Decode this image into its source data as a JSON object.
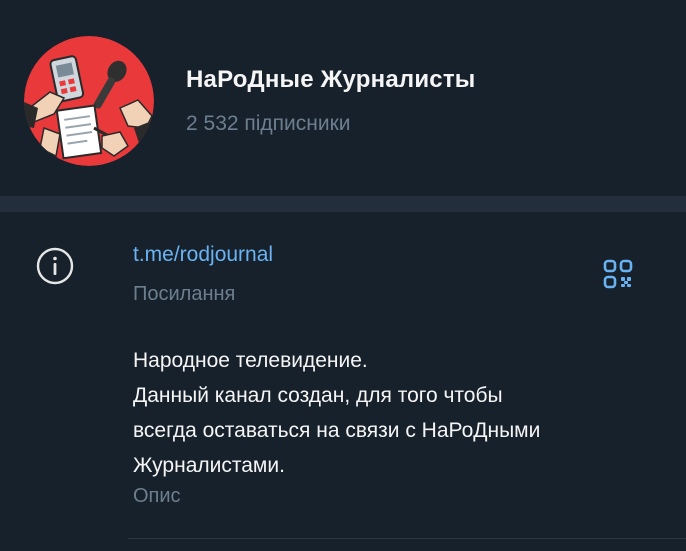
{
  "channel": {
    "title": "НаРоДные Журналисты",
    "subscribers": "2 532 підписники",
    "avatar_icon": "journalists-avatar-icon"
  },
  "info": {
    "icon": "info-icon",
    "link": "t.me/rodjournal",
    "link_caption": "Посилання",
    "qr_icon": "qr-code-icon",
    "description_lines": [
      "Народное телевидение.",
      "Данный канал создан, для того чтобы",
      "всегда оставаться на связи с НаРоДными",
      "Журналистами."
    ],
    "description_caption": "Опис"
  },
  "colors": {
    "background": "#17212b",
    "divider": "#232e3c",
    "link": "#6ab3f3",
    "secondary_text": "#6d7f8f",
    "avatar": "#e9393b"
  }
}
